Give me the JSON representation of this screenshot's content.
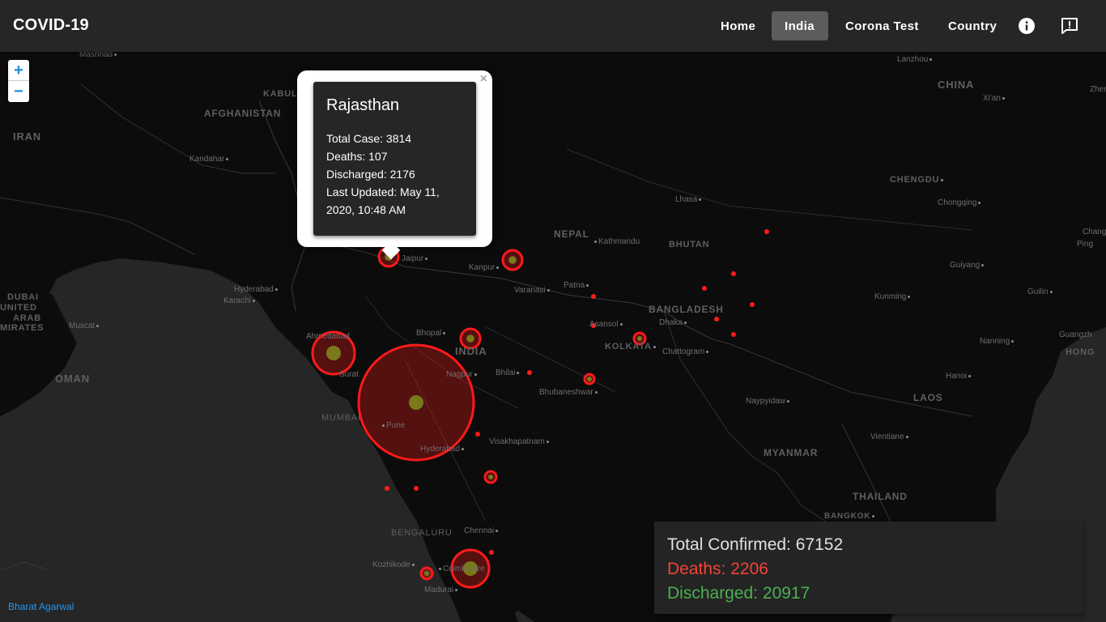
{
  "app": {
    "title": "COVID-19"
  },
  "nav": {
    "home": "Home",
    "india": "India",
    "corona_test": "Corona Test",
    "country": "Country",
    "info_icon": "info-icon",
    "feedback_icon": "feedback-icon"
  },
  "zoom": {
    "in": "+",
    "out": "−"
  },
  "map_labels": {
    "countries": [
      "AFGHANISTAN",
      "IRAN",
      "OMAN",
      "NEPAL",
      "BHUTAN",
      "BANGLADESH",
      "INDIA",
      "CHINA",
      "MYANMAR",
      "LAOS",
      "THAILAND",
      "HONG"
    ],
    "emirates": [
      "DUBAI",
      "UNITED",
      "ARAB",
      "MIRATES"
    ],
    "cities": [
      "Mashhad",
      "KABUL",
      "Kandahar",
      "Hyderabad",
      "Karachi",
      "Muscat",
      "Ahmedabad",
      "Surat",
      "MUMBAI",
      "Pune",
      "Bhopal",
      "Nagpur",
      "Jaipur",
      "Kanpur",
      "Varanasi",
      "Patna",
      "Kathmandu",
      "Asansol",
      "KOLKATA",
      "Dhaka",
      "Chattogram",
      "Bhilai",
      "Bhubaneshwar",
      "Visakhapatnam",
      "Hyderabad",
      "BENGALURU",
      "Chennai",
      "Kozhikode",
      "Coimbatore",
      "Madurai",
      "Lanzhou",
      "Xi'an",
      "Zheng",
      "CHENGDU",
      "Chongqing",
      "Lhasa",
      "Guiyang",
      "Kunming",
      "Nanning",
      "Guangzh",
      "Changsh",
      "Ping",
      "Guilin",
      "Hanoi",
      "Naypyidaw",
      "Vientiane",
      "BANGKOK"
    ]
  },
  "popup": {
    "close": "×",
    "title": "Rajasthan",
    "total_case": "Total Case: 3814",
    "deaths": "Deaths: 107",
    "discharged": "Discharged: 2176",
    "last_updated": "Last Updated: May 11, 2020, 10:48 AM"
  },
  "stats": {
    "total_confirmed": "Total Confirmed: 67152",
    "deaths": "Deaths: 2206",
    "discharged": "Discharged: 20917",
    "colors": {
      "confirmed": "#e0e0e0",
      "deaths": "#f44336",
      "discharged": "#4caf50"
    }
  },
  "credit": "Bharat Agarwal",
  "colors": {
    "marker": "#ff1a1a",
    "marker_center": "#7a7a1a",
    "appbar": "#262626",
    "map_bg": "#191a1a",
    "land": "#0c0c0c",
    "water": "#262626"
  },
  "markers": [
    {
      "name": "Maharashtra",
      "size": "large"
    },
    {
      "name": "Gujarat",
      "size": "medium"
    },
    {
      "name": "Tamil Nadu",
      "size": "medium"
    },
    {
      "name": "Rajasthan",
      "size": "small"
    },
    {
      "name": "Madhya Pradesh",
      "size": "small"
    },
    {
      "name": "Uttar Pradesh",
      "size": "small"
    },
    {
      "name": "West Bengal",
      "size": "small"
    },
    {
      "name": "Andhra Pradesh",
      "size": "small"
    },
    {
      "name": "Kerala",
      "size": "small"
    },
    {
      "name": "Odisha",
      "size": "small"
    }
  ]
}
